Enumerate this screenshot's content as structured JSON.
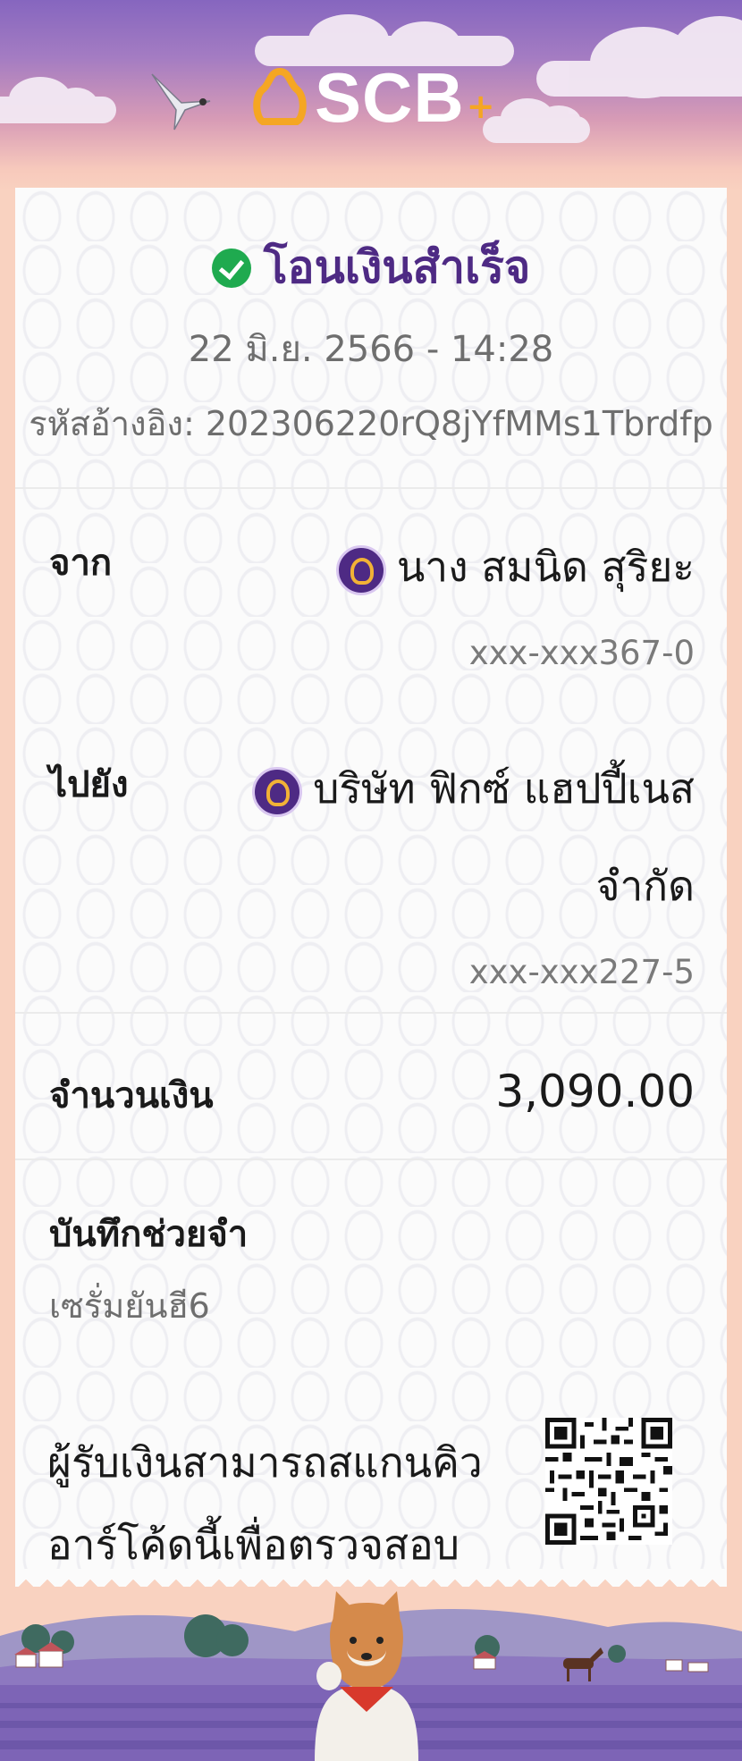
{
  "brand": {
    "logo_text": "SCB",
    "logo_plus": "+",
    "accent": "#4e2a84",
    "gold": "#f2b236",
    "success": "#1faa4f"
  },
  "status": {
    "title": "โอนเงินสำเร็จ",
    "icon": "check-circle-icon"
  },
  "datetime": "22 มิ.ย. 2566 - 14:28",
  "reference": "รหัสอ้างอิง: 202306220rQ8jYfMMs1Tbrdfp",
  "from": {
    "label": "จาก",
    "name": "นาง สมนิด สุริยะ",
    "account": "xxx-xxx367-0"
  },
  "to": {
    "label": "ไปยัง",
    "name_line1": "บริษัท ฟิกซ์ แฮปปี้เนส",
    "name_line2": "จำกัด",
    "account": "xxx-xxx227-5"
  },
  "amount": {
    "label": "จำนวนเงิน",
    "value": "3,090.00"
  },
  "memo": {
    "label": "บันทึกช่วยจำ",
    "value": "เซรั่มยันฮี6"
  },
  "qr": {
    "line1": "ผู้รับเงินสามารถสแกนคิว",
    "line2": "อาร์โค้ดนี้เพื่อตรวจสอบ"
  }
}
